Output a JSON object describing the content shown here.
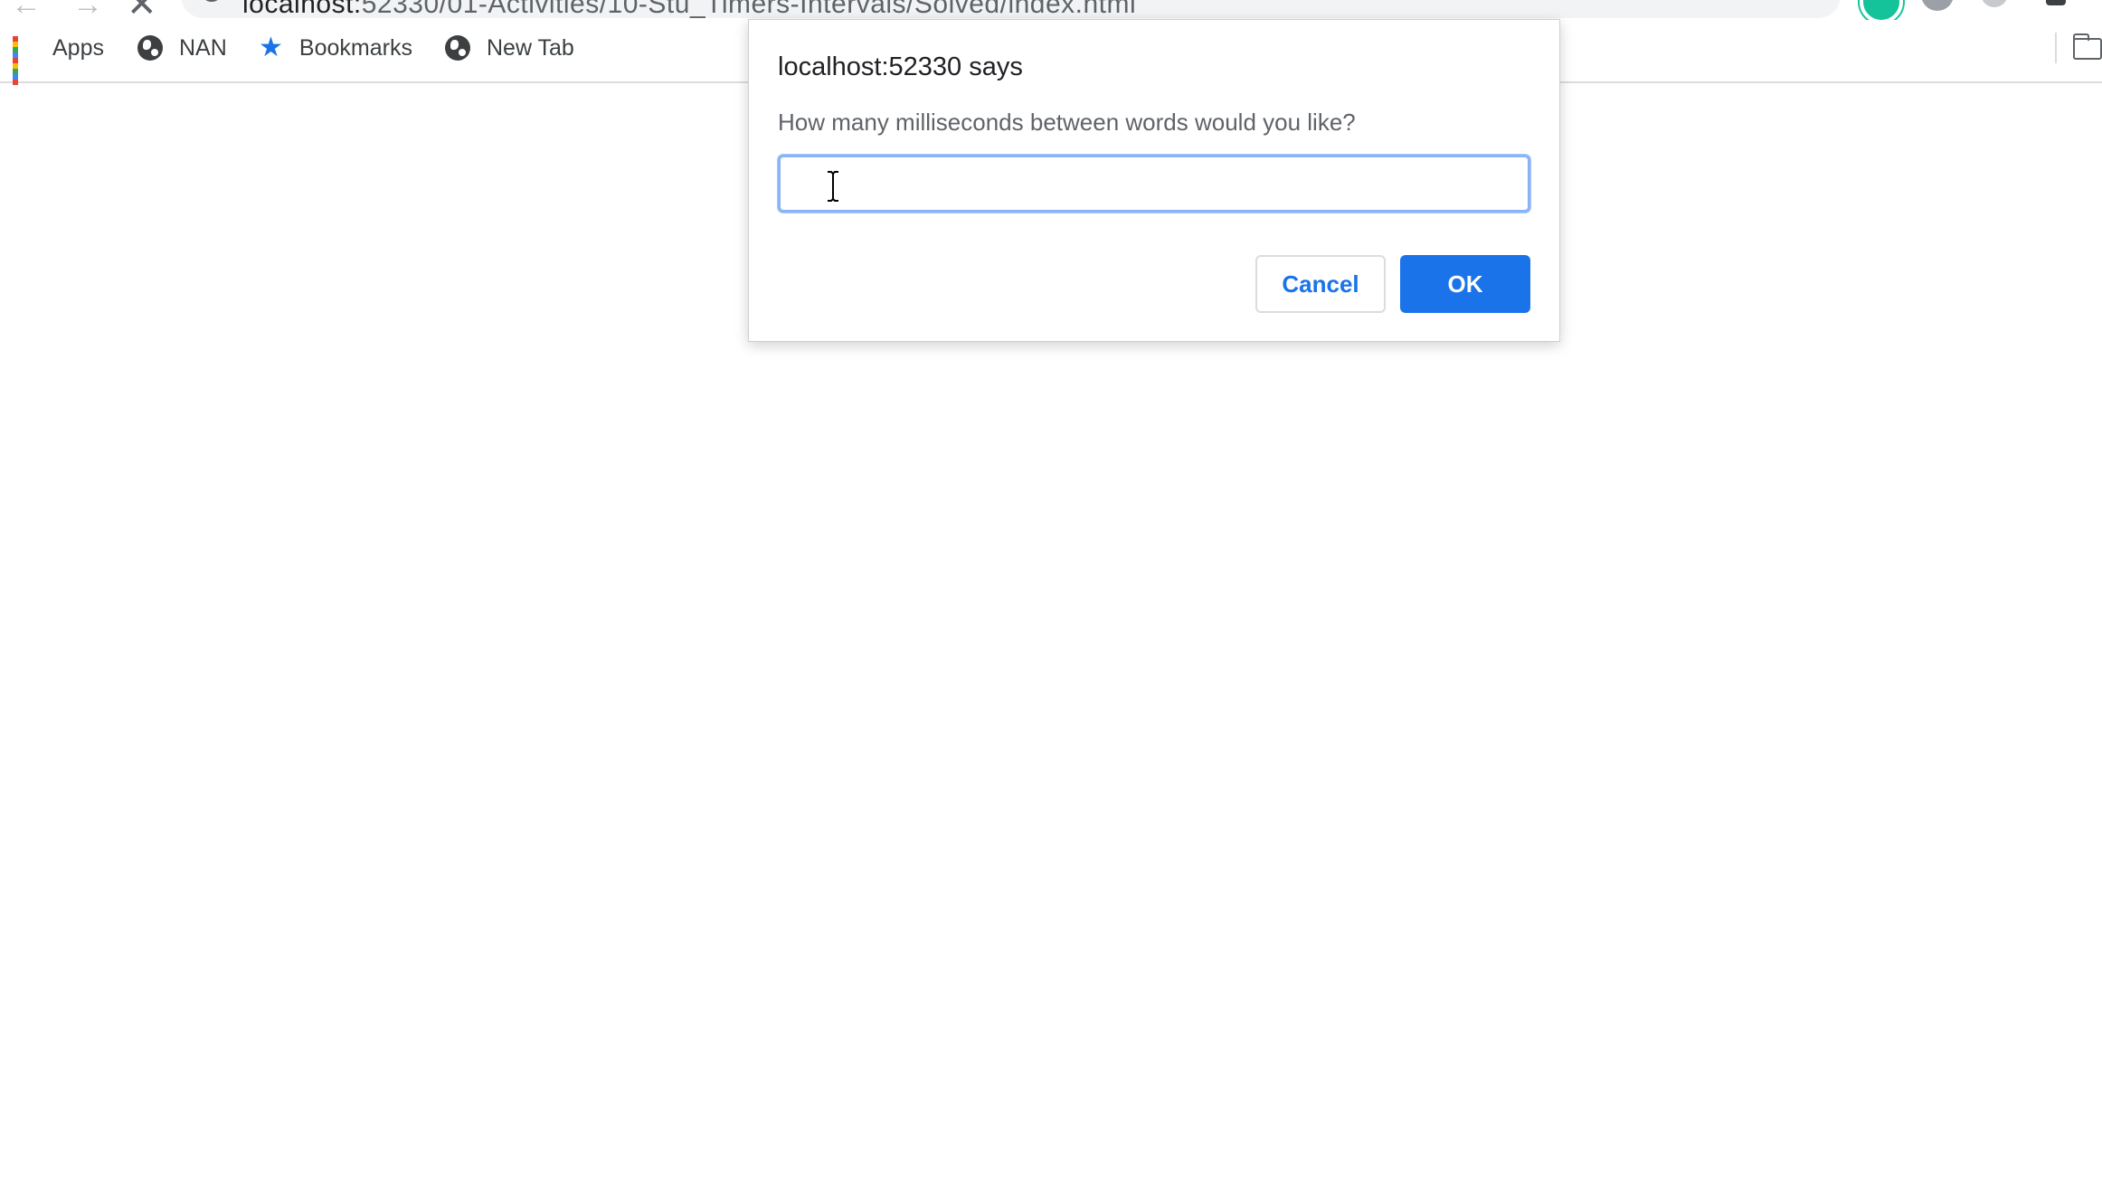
{
  "browser": {
    "address_host": "localhost:",
    "address_path": "52330/01-Activities/10-Stu_Timers-Intervals/Solved/index.html"
  },
  "bookmarks": {
    "items": [
      {
        "label": "Apps",
        "icon": "apps-grid-icon"
      },
      {
        "label": "NAN",
        "icon": "globe-icon"
      },
      {
        "label": "Bookmarks",
        "icon": "star-icon"
      },
      {
        "label": "New Tab",
        "icon": "globe-icon"
      }
    ]
  },
  "dialog": {
    "title": "localhost:52330 says",
    "message": "How many milliseconds between words would you like?",
    "input_value": "",
    "cancel_label": "Cancel",
    "ok_label": "OK"
  },
  "colors": {
    "accent": "#1a73e8",
    "input_focus_border": "#8ab4f8",
    "dialog_border": "#cfcfcf",
    "bookmark_text": "#3c4043"
  }
}
